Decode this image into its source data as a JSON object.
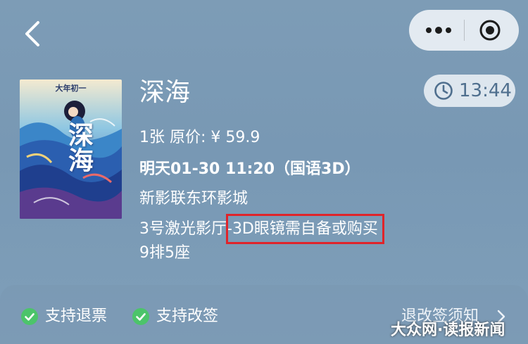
{
  "nav": {
    "back_icon": "chevron-left-icon",
    "more_icon": "more-dots-icon",
    "close_icon": "target-close-icon"
  },
  "movie": {
    "poster_caption": "大年初一",
    "poster_title": "深海",
    "title": "深海",
    "countdown": "13:44",
    "price_line": "1张 原价: ¥ 59.9",
    "showtime": "明天01-30 11:20（国语3D）",
    "cinema": "新影联东环影城",
    "hall_prefix": "3号激光影厅-",
    "hall_note": "3D眼镜需自备或购买",
    "seat": "9排5座"
  },
  "features": {
    "refund": "支持退票",
    "change": "支持改签",
    "notice": "退改签须知",
    "check_color": "#4cc46a"
  },
  "watermark": {
    "text": "大众网·读报新闻"
  },
  "colors": {
    "highlight": "#e0242a",
    "background": "#7b9ab5"
  }
}
